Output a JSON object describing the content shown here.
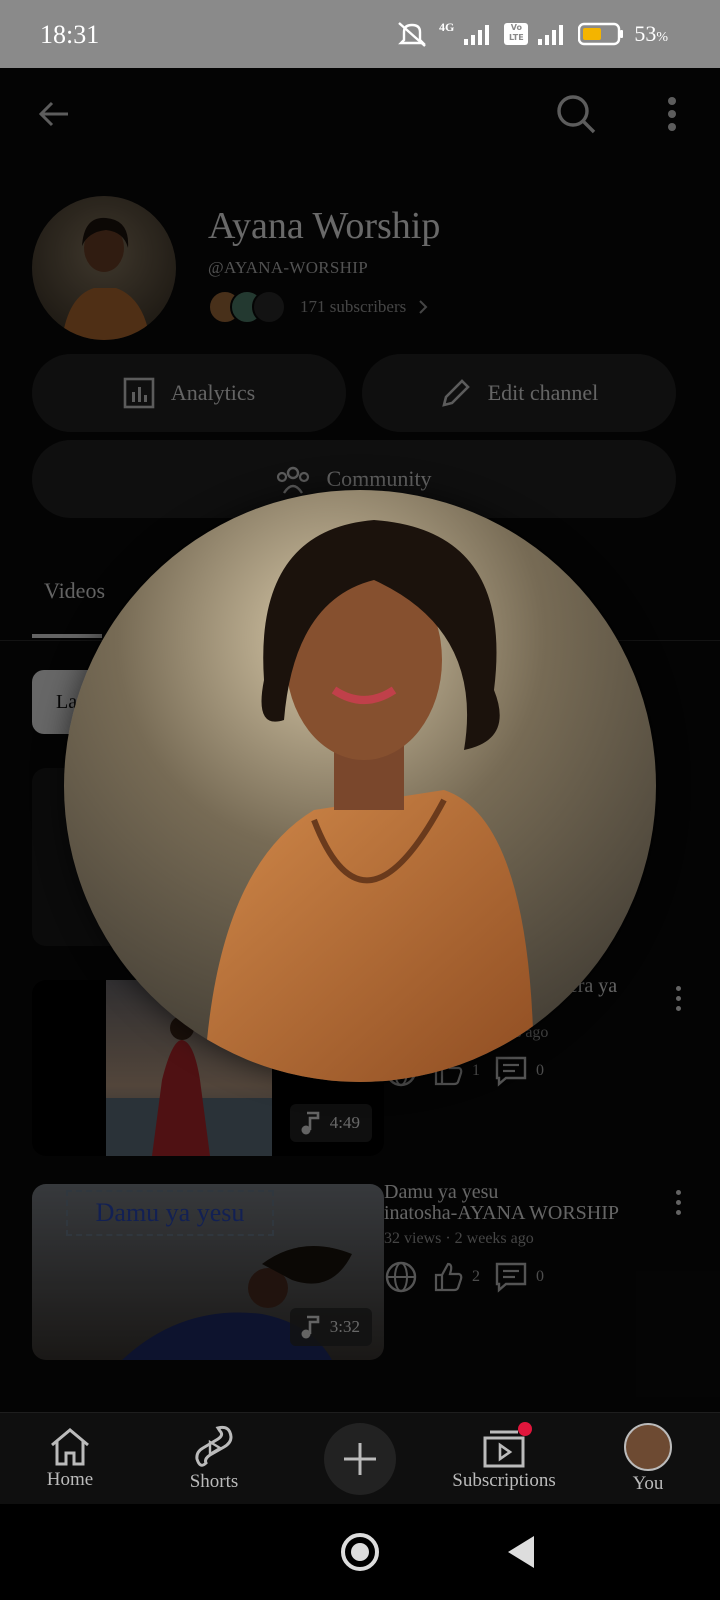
{
  "status_bar": {
    "time": "18:31",
    "network": "4G",
    "volte": "Vo LTE",
    "battery": "53",
    "battery_unit": "%"
  },
  "channel": {
    "name": "Ayana Worship",
    "handle": "@AYANA-WORSHIP",
    "subscribers": "171 subscribers"
  },
  "actions": {
    "analytics": "Analytics",
    "edit_channel": "Edit channel",
    "community": "Community"
  },
  "tabs": [
    {
      "label": "Videos"
    }
  ],
  "filter_chip": {
    "label": "La"
  },
  "videos": [
    {
      "title_line1": "",
      "title_fragment": "bedera ya",
      "meta": "8 days ago",
      "likes": "1",
      "comments": "0",
      "duration": "4:49"
    },
    {
      "title_line1": "Damu ya yesu",
      "title_line2": "inatosha-AYANA WORSHIP",
      "views": "32 views",
      "sep": "·",
      "meta": "2 weeks ago",
      "likes": "2",
      "comments": "0",
      "duration": "3:32",
      "thumb_text": "Damu ya yesu"
    }
  ],
  "bottom_nav": [
    {
      "label": "Home",
      "icon": "home-icon"
    },
    {
      "label": "Shorts",
      "icon": "shorts-icon"
    },
    {
      "label": "",
      "icon": "create-plus-icon"
    },
    {
      "label": "Subscriptions",
      "icon": "subscriptions-icon"
    },
    {
      "label": "You",
      "icon": "avatar"
    }
  ],
  "colors": {
    "background": "#0b0b0b",
    "pill": "#222222",
    "accent_dot": "#e0163c",
    "status_bar": "#8a8a8a"
  }
}
